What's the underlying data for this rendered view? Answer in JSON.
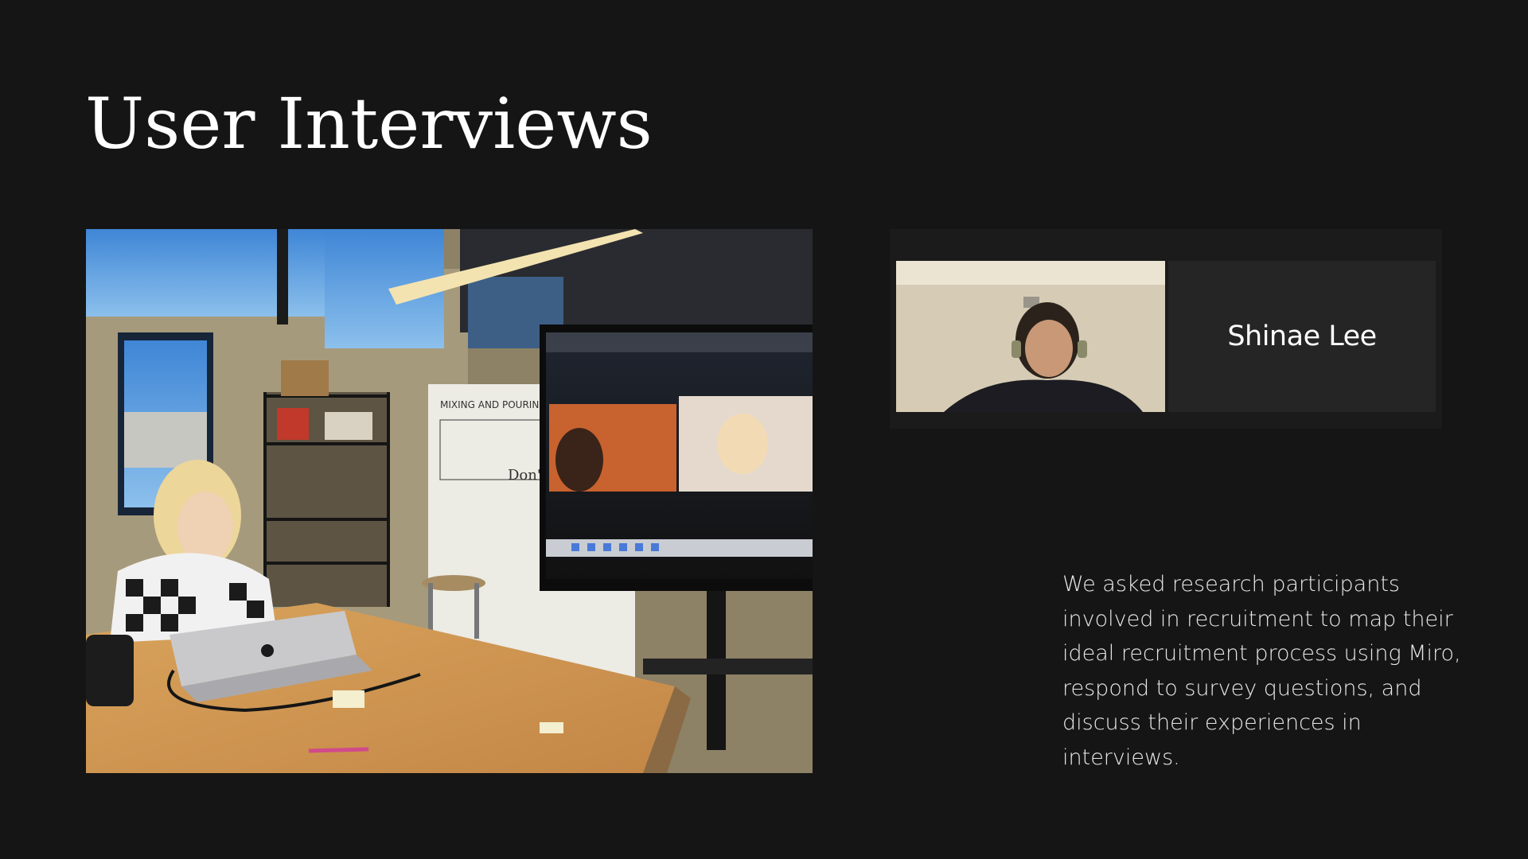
{
  "slide": {
    "title": "User Interviews",
    "description": "We asked research participants involved in recruitment to map their ideal recruitment process using Miro, respond to survey questions, and discuss their experiences in interviews.",
    "background_color": "#151515"
  },
  "photo": {
    "whiteboard_heading": "MIXING AND POURING",
    "whiteboard_note": "Don't"
  },
  "video_call": {
    "participant_name": "Shinae Lee"
  },
  "icons": {
    "laptop_logo": "apple-logo-icon"
  }
}
